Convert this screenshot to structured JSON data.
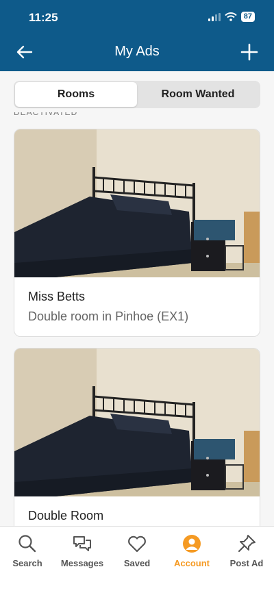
{
  "status": {
    "time": "11:25",
    "battery": "87"
  },
  "nav": {
    "title": "My Ads"
  },
  "segments": [
    {
      "label": "Rooms",
      "active": true
    },
    {
      "label": "Room Wanted",
      "active": false
    }
  ],
  "section_label": "DEACTIVATED",
  "ads": [
    {
      "title": "Miss Betts",
      "subtitle": "Double room in Pinhoe (EX1)"
    },
    {
      "title": "Double Room",
      "subtitle": ""
    }
  ],
  "tabbar": {
    "items": [
      {
        "label": "Search",
        "icon": "search-icon"
      },
      {
        "label": "Messages",
        "icon": "messages-icon"
      },
      {
        "label": "Saved",
        "icon": "heart-icon"
      },
      {
        "label": "Account",
        "icon": "account-icon",
        "active": true
      },
      {
        "label": "Post Ad",
        "icon": "pin-icon"
      }
    ]
  },
  "colors": {
    "header": "#0e5a8a",
    "accent": "#f59a23"
  }
}
